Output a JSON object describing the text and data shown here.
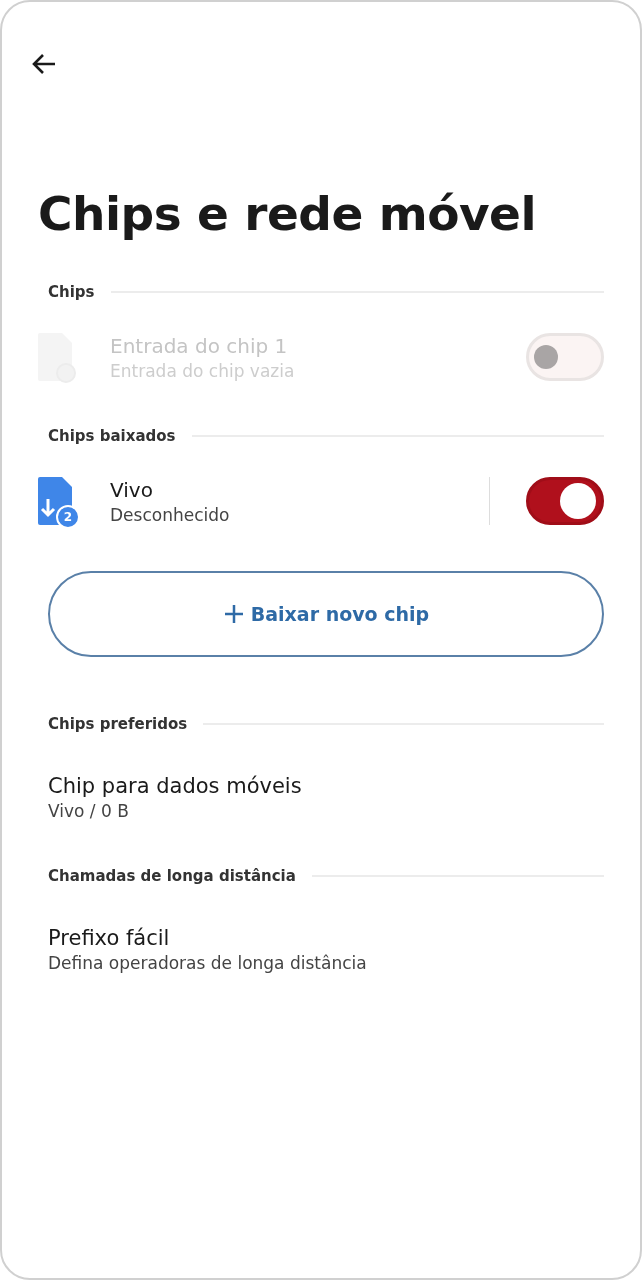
{
  "title": "Chips e rede móvel",
  "sections": [
    {
      "header": "Chips",
      "items": [
        {
          "kind": "sim",
          "title": "Entrada do chip 1",
          "subtitle": "Entrada do chip vazia",
          "disabled": true,
          "on": false
        }
      ]
    },
    {
      "header": "Chips baixados",
      "items": [
        {
          "kind": "sim",
          "title": "Vivo",
          "subtitle": "Desconhecido",
          "badge": "2",
          "disabled": false,
          "on": true
        },
        {
          "kind": "button",
          "label": "Baixar novo chip"
        }
      ]
    },
    {
      "header": "Chips preferidos",
      "items": [
        {
          "kind": "plain",
          "title": "Chip para dados móveis",
          "subtitle": "Vivo / 0 B"
        }
      ]
    },
    {
      "header": "Chamadas de longa distância",
      "items": [
        {
          "kind": "plain",
          "title": "Prefixo fácil",
          "subtitle": "Defina operadoras de longa distância"
        }
      ]
    }
  ]
}
